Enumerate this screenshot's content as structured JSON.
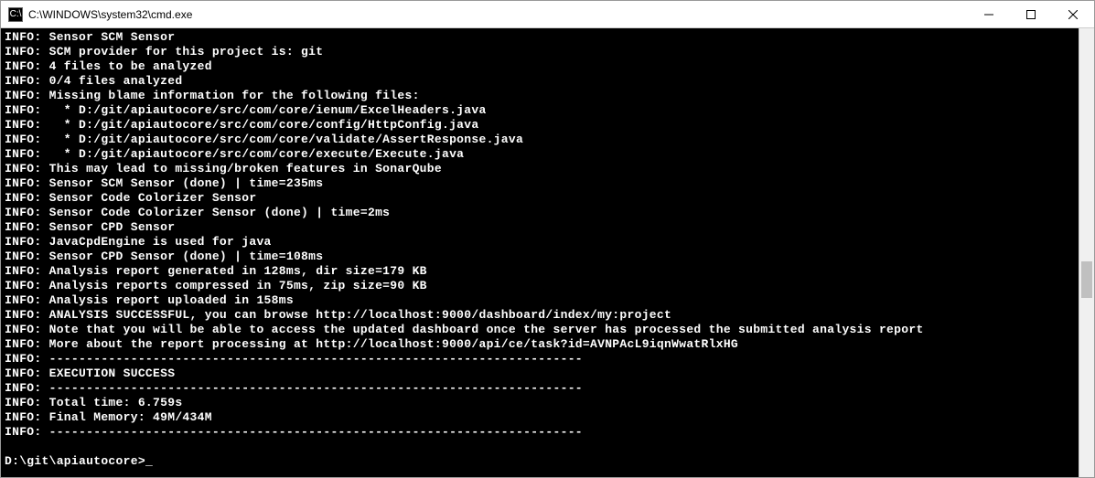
{
  "window": {
    "title": "C:\\WINDOWS\\system32\\cmd.exe",
    "icon_label": "cmd"
  },
  "console": {
    "lines": [
      {
        "prefix": "INFO:",
        "text": " Sensor SCM Sensor"
      },
      {
        "prefix": "INFO:",
        "text": " SCM provider for this project is: git"
      },
      {
        "prefix": "INFO:",
        "text": " 4 files to be analyzed"
      },
      {
        "prefix": "INFO:",
        "text": " 0/4 files analyzed"
      },
      {
        "prefix": "INFO:",
        "text": " Missing blame information for the following files:"
      },
      {
        "prefix": "INFO:",
        "text": "   * D:/git/apiautocore/src/com/core/ienum/ExcelHeaders.java"
      },
      {
        "prefix": "INFO:",
        "text": "   * D:/git/apiautocore/src/com/core/config/HttpConfig.java"
      },
      {
        "prefix": "INFO:",
        "text": "   * D:/git/apiautocore/src/com/core/validate/AssertResponse.java"
      },
      {
        "prefix": "INFO:",
        "text": "   * D:/git/apiautocore/src/com/core/execute/Execute.java"
      },
      {
        "prefix": "INFO:",
        "text": " This may lead to missing/broken features in SonarQube"
      },
      {
        "prefix": "INFO:",
        "text": " Sensor SCM Sensor (done) | time=235ms"
      },
      {
        "prefix": "INFO:",
        "text": " Sensor Code Colorizer Sensor"
      },
      {
        "prefix": "INFO:",
        "text": " Sensor Code Colorizer Sensor (done) | time=2ms"
      },
      {
        "prefix": "INFO:",
        "text": " Sensor CPD Sensor"
      },
      {
        "prefix": "INFO:",
        "text": " JavaCpdEngine is used for java"
      },
      {
        "prefix": "INFO:",
        "text": " Sensor CPD Sensor (done) | time=108ms"
      },
      {
        "prefix": "INFO:",
        "text": " Analysis report generated in 128ms, dir size=179 KB"
      },
      {
        "prefix": "INFO:",
        "text": " Analysis reports compressed in 75ms, zip size=90 KB"
      },
      {
        "prefix": "INFO:",
        "text": " Analysis report uploaded in 158ms"
      },
      {
        "prefix": "INFO:",
        "text": " ANALYSIS SUCCESSFUL, you can browse http://localhost:9000/dashboard/index/my:project"
      },
      {
        "prefix": "INFO:",
        "text": " Note that you will be able to access the updated dashboard once the server has processed the submitted analysis report"
      },
      {
        "prefix": "INFO:",
        "text": " More about the report processing at http://localhost:9000/api/ce/task?id=AVNPAcL9iqnWwatRlxHG"
      },
      {
        "prefix": "INFO:",
        "text": " ------------------------------------------------------------------------"
      },
      {
        "prefix": "INFO:",
        "text": " EXECUTION SUCCESS"
      },
      {
        "prefix": "INFO:",
        "text": " ------------------------------------------------------------------------"
      },
      {
        "prefix": "INFO:",
        "text": " Total time: 6.759s"
      },
      {
        "prefix": "INFO:",
        "text": " Final Memory: 49M/434M"
      },
      {
        "prefix": "INFO:",
        "text": " ------------------------------------------------------------------------"
      }
    ],
    "prompt": "D:\\git\\apiautocore>",
    "cursor": "_"
  }
}
